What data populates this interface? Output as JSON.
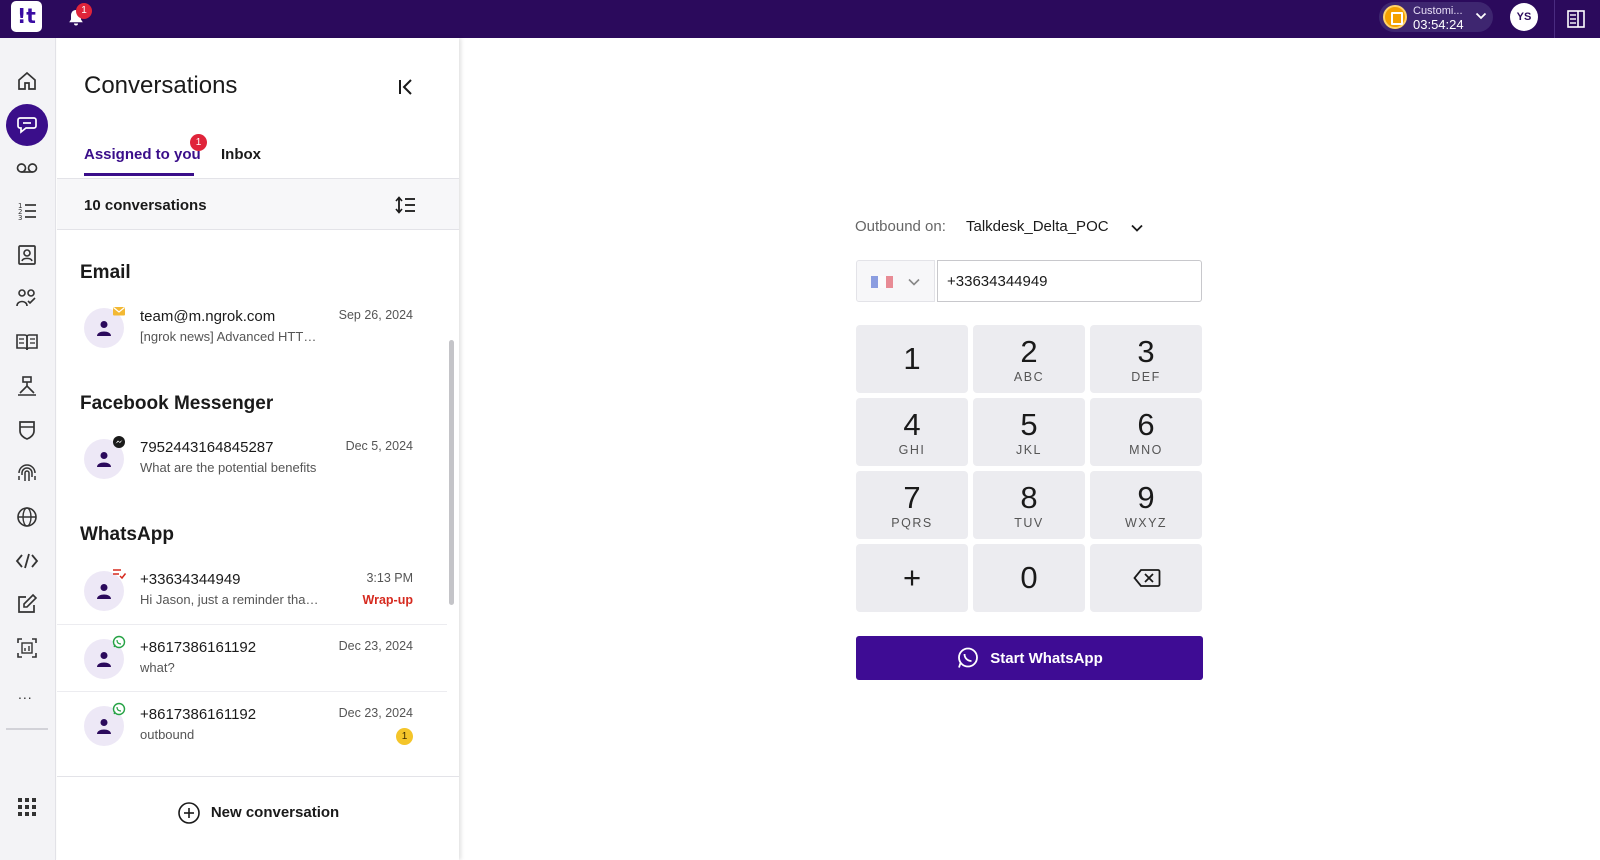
{
  "topbar": {
    "logo_text": "!t",
    "notification_count": "1",
    "status_name": "Customi...",
    "status_timer": "03:54:24",
    "user_initials": "YS"
  },
  "rail": {
    "items": [
      "home-icon",
      "conversations-icon",
      "voicemail-icon",
      "lists-icon",
      "contacts-icon",
      "team-icon",
      "knowledge-icon",
      "flows-icon",
      "shield-icon",
      "fingerprint-icon",
      "globe-icon",
      "code-icon",
      "edit-icon",
      "reports-icon"
    ],
    "more_label": "...",
    "active_item": "conversations-icon"
  },
  "panel": {
    "title": "Conversations",
    "tabs": [
      {
        "label": "Assigned to you",
        "badge": "1",
        "active": true
      },
      {
        "label": "Inbox",
        "active": false
      }
    ],
    "count_label": "10 conversations",
    "sections": [
      {
        "title": "Email",
        "items": [
          {
            "name": "team@m.ngrok.com",
            "preview": "[ngrok news] Advanced HTTP traffic",
            "date": "Sep 26, 2024",
            "channel": "email-icon"
          }
        ]
      },
      {
        "title": "Facebook Messenger",
        "items": [
          {
            "name": "7952443164845287",
            "preview": "What are the potential benefits",
            "date": "Dec 5, 2024",
            "channel": "messenger-icon"
          }
        ]
      },
      {
        "title": "WhatsApp",
        "items": [
          {
            "name": "+33634344949",
            "preview": "Hi Jason, just a reminder that your",
            "date": "3:13 PM",
            "status": "Wrap-up",
            "channel": "whatsapp-icon"
          },
          {
            "name": "+8617386161192",
            "preview": "what?",
            "date": "Dec 23, 2024",
            "channel": "whatsapp-icon"
          },
          {
            "name": "+8617386161192",
            "preview": "outbound",
            "date": "Dec 23, 2024",
            "unread": "1",
            "channel": "whatsapp-icon"
          }
        ]
      }
    ],
    "new_conversation_label": "New conversation"
  },
  "dialer": {
    "outbound_label": "Outbound on:",
    "outbound_value": "Talkdesk_Delta_POC",
    "country_flag": "flag-fr-icon",
    "phone_value": "+33634344949",
    "keys": [
      {
        "digit": "1",
        "letters": ""
      },
      {
        "digit": "2",
        "letters": "ABC"
      },
      {
        "digit": "3",
        "letters": "DEF"
      },
      {
        "digit": "4",
        "letters": "GHI"
      },
      {
        "digit": "5",
        "letters": "JKL"
      },
      {
        "digit": "6",
        "letters": "MNO"
      },
      {
        "digit": "7",
        "letters": "PQRS"
      },
      {
        "digit": "8",
        "letters": "TUV"
      },
      {
        "digit": "9",
        "letters": "WXYZ"
      },
      {
        "digit": "+",
        "letters": ""
      },
      {
        "digit": "0",
        "letters": ""
      }
    ],
    "start_label": "Start WhatsApp"
  },
  "colors": {
    "topbar": "#2b0a5c",
    "accent": "#3e0c94",
    "wrapup": "#d62a1f",
    "badge": "#e0243a",
    "unread": "#f4c52a"
  }
}
